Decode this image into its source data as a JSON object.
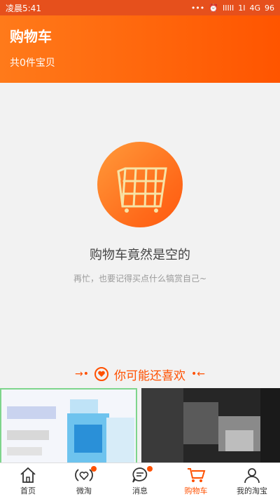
{
  "status_bar": {
    "time": "凌晨5:41",
    "right": [
      "•••",
      "⏰",
      "IIIII",
      "1I",
      "4G",
      "96"
    ]
  },
  "header": {
    "title": "购物车",
    "count_text": "共0件宝贝"
  },
  "empty_state": {
    "message": "购物车竟然是空的",
    "subtext": "再忙，也要记得买点什么犒赏自己~"
  },
  "recommend": {
    "title": "你可能还喜欢"
  },
  "tabs": [
    {
      "label": "首页",
      "icon": "home-icon",
      "active": false
    },
    {
      "label": "微淘",
      "icon": "weitao-icon",
      "active": false
    },
    {
      "label": "消息",
      "icon": "message-icon",
      "active": false
    },
    {
      "label": "购物车",
      "icon": "cart-icon",
      "active": true
    },
    {
      "label": "我的淘宝",
      "icon": "user-icon",
      "active": false
    }
  ],
  "colors": {
    "accent": "#ff5000",
    "header_gradient_start": "#ff7a1a",
    "header_gradient_end": "#ff5500"
  }
}
